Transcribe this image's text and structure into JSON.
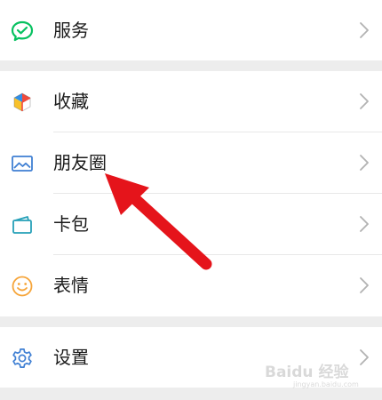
{
  "menu": {
    "services": {
      "label": "服务",
      "icon": "wechat-pay-icon"
    },
    "favorites": {
      "label": "收藏",
      "icon": "cube-icon"
    },
    "moments": {
      "label": "朋友圈",
      "icon": "image-icon"
    },
    "cards": {
      "label": "卡包",
      "icon": "wallet-icon"
    },
    "stickers": {
      "label": "表情",
      "icon": "smile-icon"
    },
    "settings": {
      "label": "设置",
      "icon": "gear-icon"
    }
  },
  "colors": {
    "services_icon": "#07c160",
    "moments_icon": "#3f7fd3",
    "cards_icon": "#26a0b8",
    "stickers_icon": "#f6a53a",
    "settings_icon": "#3f7fd3",
    "annotation_arrow": "#e5141b",
    "chevron": "#b2b2b2"
  },
  "watermark": {
    "text": "Baidu 经验",
    "subtext": "jingyan.baidu.com"
  }
}
